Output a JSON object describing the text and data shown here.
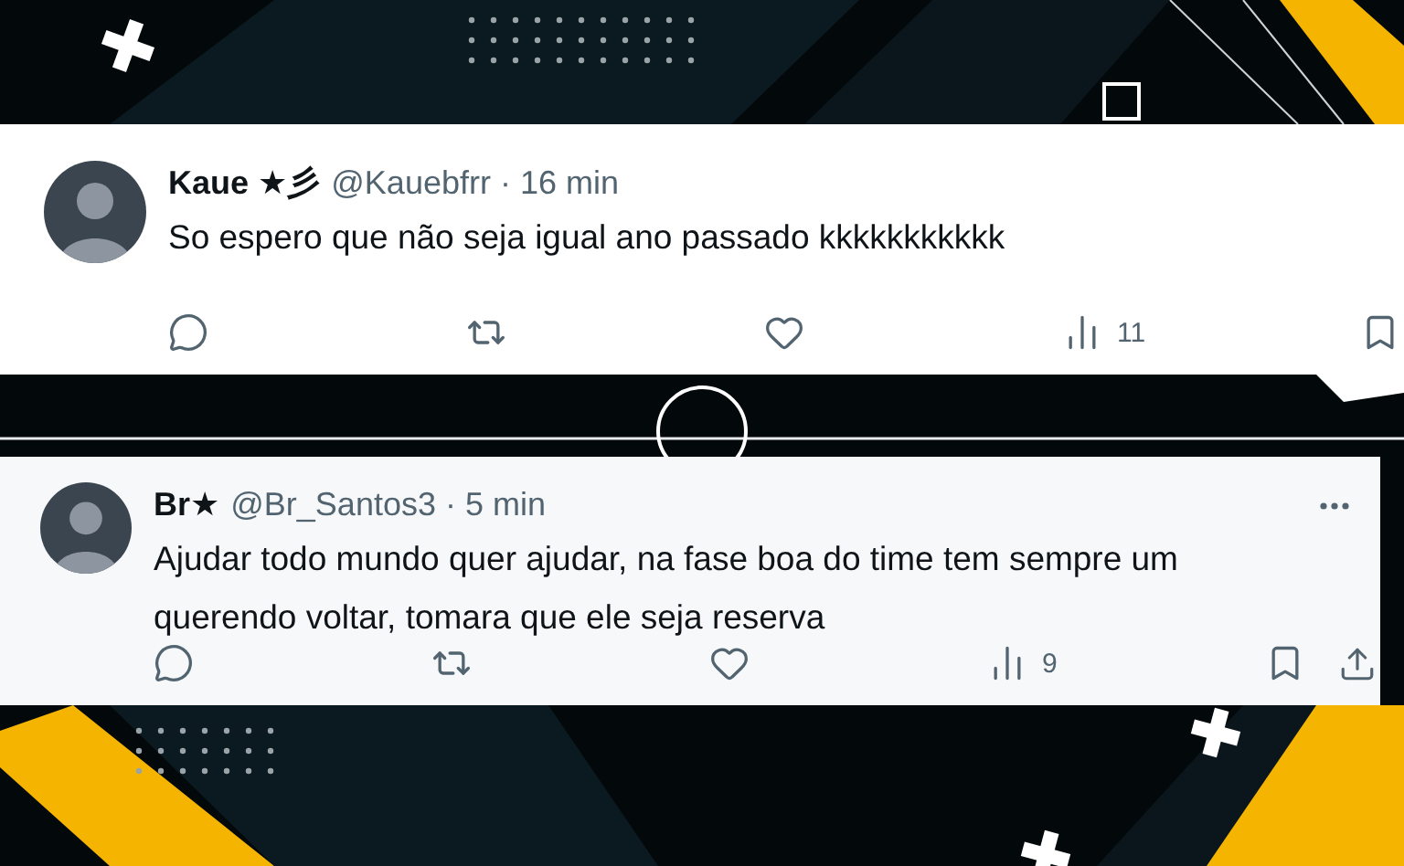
{
  "tweets": [
    {
      "name": "Kaue ★彡",
      "handle": "@Kauebfrr",
      "separator": "·",
      "time": "16 min",
      "lines": [
        "So espero que não seja igual ano passado kkkkkkkkkkk"
      ],
      "has_menu": false,
      "actions": [
        {
          "kind": "reply"
        },
        {
          "kind": "retweet"
        },
        {
          "kind": "like"
        },
        {
          "kind": "views",
          "count": "11"
        },
        {
          "kind": "bookmark"
        }
      ]
    },
    {
      "name": "Br★",
      "handle": "@Br_Santos3",
      "separator": "·",
      "time": "5 min",
      "lines": [
        "Ajudar todo mundo quer ajudar, na fase boa do time  tem sempre um",
        "querendo voltar, tomara  que  ele seja reserva"
      ],
      "has_menu": true,
      "actions": [
        {
          "kind": "reply"
        },
        {
          "kind": "retweet"
        },
        {
          "kind": "like"
        },
        {
          "kind": "views",
          "count": "9"
        },
        {
          "kind": "bookmark"
        },
        {
          "kind": "share"
        }
      ]
    }
  ]
}
